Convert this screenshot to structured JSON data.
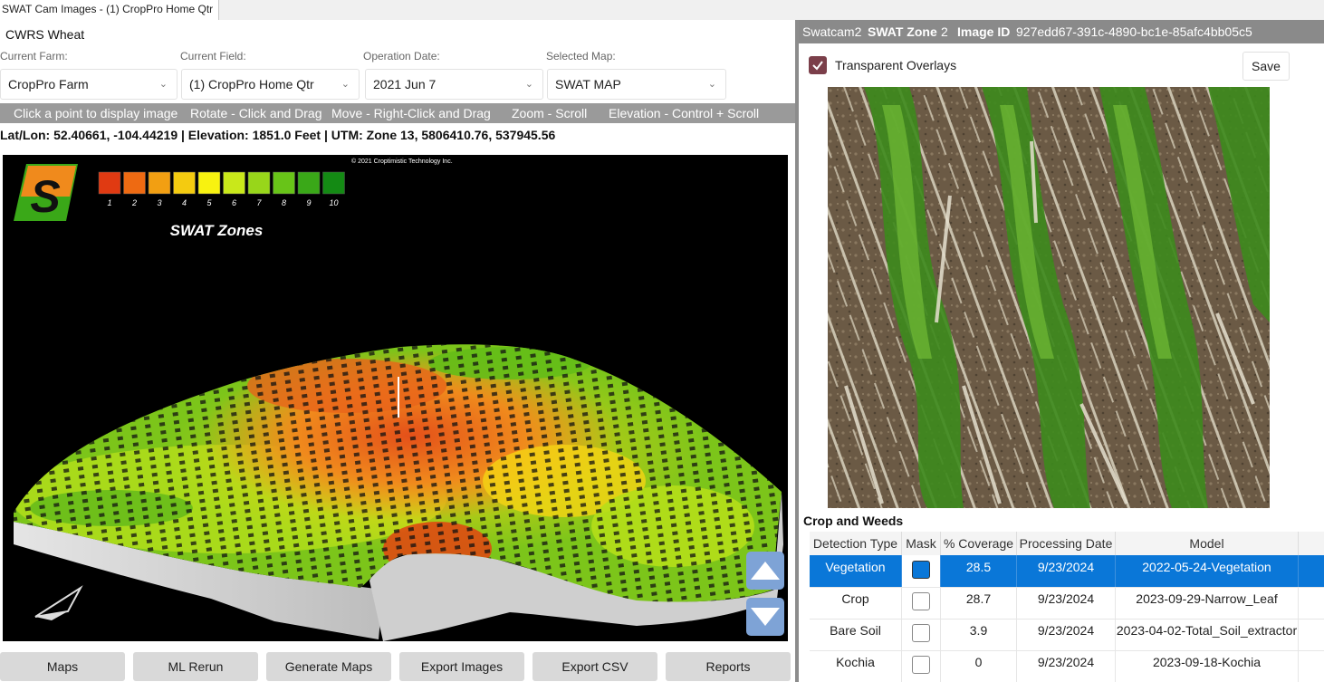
{
  "window": {
    "tab_title": "SWAT Cam Images - (1) CropPro Home Qtr"
  },
  "crop": "CWRS Wheat",
  "fields": {
    "farm": {
      "label": "Current Farm:",
      "value": "CropPro Farm"
    },
    "field": {
      "label": "Current Field:",
      "value": "(1) CropPro Home Qtr"
    },
    "date": {
      "label": "Operation Date:",
      "value": "2021 Jun 7"
    },
    "map": {
      "label": "Selected Map:",
      "value": "SWAT MAP"
    }
  },
  "instructions": [
    "Click a point to display image",
    "Rotate - Click and Drag",
    "Move - Right-Click and Drag",
    "Zoom - Scroll",
    "Elevation - Control + Scroll"
  ],
  "location": "Lat/Lon: 52.40661, -104.44219 | Elevation: 1851.0 Feet | UTM: Zone 13, 5806410.76, 537945.56",
  "map": {
    "copyright": "© 2021 Croptimistic Technology Inc.",
    "title": "SWAT Zones",
    "logo_letter": "S",
    "legend": [
      {
        "label": "1",
        "color": "#e03a12"
      },
      {
        "label": "2",
        "color": "#ee6a12"
      },
      {
        "label": "3",
        "color": "#f29f12"
      },
      {
        "label": "4",
        "color": "#f4cb10"
      },
      {
        "label": "5",
        "color": "#f8f210"
      },
      {
        "label": "6",
        "color": "#c9e81a"
      },
      {
        "label": "7",
        "color": "#98d61a"
      },
      {
        "label": "8",
        "color": "#68c418"
      },
      {
        "label": "9",
        "color": "#3aa818"
      },
      {
        "label": "10",
        "color": "#148a14"
      }
    ]
  },
  "buttons": [
    "Maps",
    "ML Rerun",
    "Generate Maps",
    "Export Images",
    "Export CSV",
    "Reports"
  ],
  "right": {
    "camera": "Swatcam2",
    "zone_label": "SWAT Zone",
    "zone_value": "2",
    "image_id_label": "Image ID",
    "image_id_value": "927edd67-391c-4890-bc1e-85afc4bb05c5",
    "overlay_label": "Transparent Overlays",
    "overlay_checked": true,
    "save_label": "Save",
    "section_title": "Crop and Weeds",
    "columns": [
      "Detection Type",
      "Mask",
      "% Coverage",
      "Processing Date",
      "Model"
    ],
    "rows": [
      {
        "type": "Vegetation",
        "coverage": "28.5",
        "date": "9/23/2024",
        "model": "2022-05-24-Vegetation",
        "selected": true
      },
      {
        "type": "Crop",
        "coverage": "28.7",
        "date": "9/23/2024",
        "model": "2023-09-29-Narrow_Leaf",
        "selected": false
      },
      {
        "type": "Bare Soil",
        "coverage": "3.9",
        "date": "9/23/2024",
        "model": "2023-04-02-Total_Soil_extractor",
        "selected": false
      },
      {
        "type": "Kochia",
        "coverage": "0",
        "date": "9/23/2024",
        "model": "2023-09-18-Kochia",
        "selected": false
      }
    ]
  }
}
